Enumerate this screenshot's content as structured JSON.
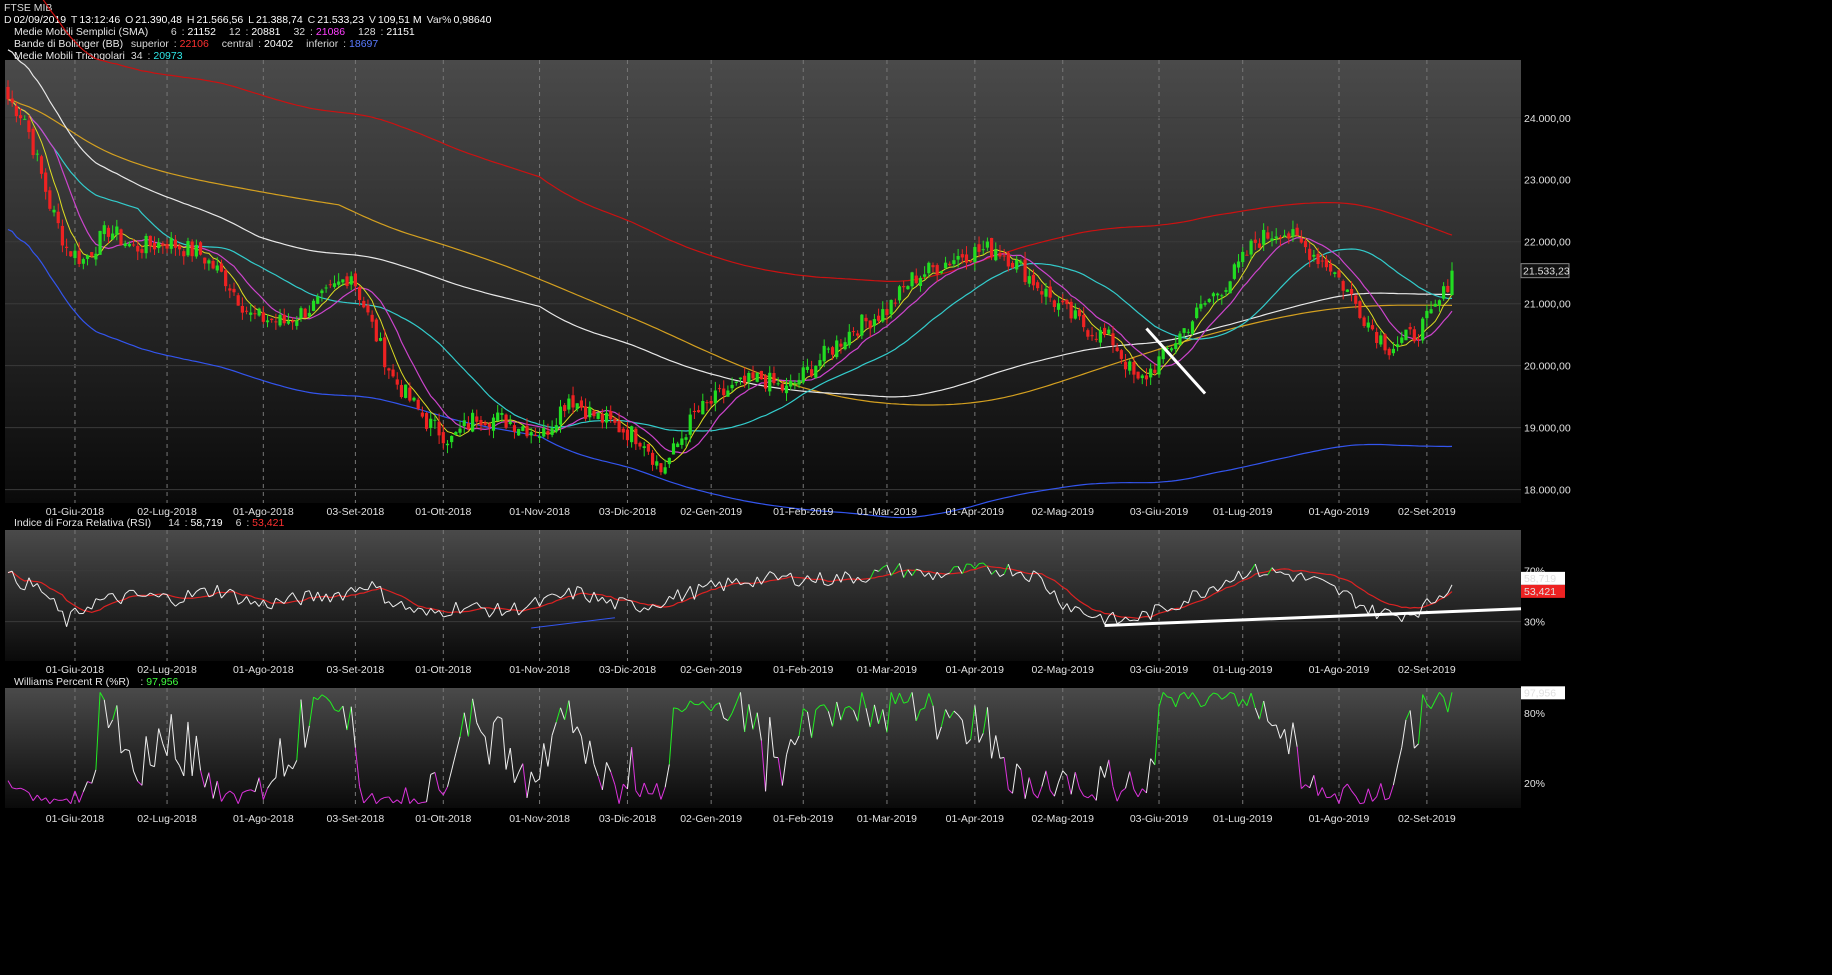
{
  "header": {
    "title": "FTSE MIB",
    "ohlc": {
      "d_label": "D",
      "date": "02/09/2019",
      "t_label": "T",
      "time": "13:12:46",
      "o_label": "O",
      "open": "21.390,48",
      "h_label": "H",
      "high": "21.566,56",
      "l_label": "L",
      "low": "21.388,74",
      "c_label": "C",
      "close": "21.533,23",
      "v_label": "V",
      "volume": "109,51 M",
      "var_label": "Var%",
      "var": "0,98640"
    },
    "sma": {
      "label": "Medie Mobili Semplici (SMA)",
      "p1": "6",
      "v1": "21152",
      "p2": "12",
      "v2": "20881",
      "p3": "32",
      "v3": "21086",
      "p4": "128",
      "v4": "21151"
    },
    "bb": {
      "label": "Bande di Bollinger (BB)",
      "sup_label": "superior",
      "sup": "22106",
      "cen_label": "central",
      "cen": "20402",
      "inf_label": "inferior",
      "inf": "18697"
    },
    "tma": {
      "label": "Medie Mobili Triangolari",
      "p": "34",
      "v": "20973"
    }
  },
  "rsi_header": {
    "label": "Indice di Forza Relativa (RSI)",
    "p1": "14",
    "v1": "58,719",
    "p2": "6",
    "v2": "53,421"
  },
  "wr_header": {
    "label": "Williams Percent R (%R)",
    "v": "97,956"
  },
  "colors": {
    "up": "#22dd22",
    "down": "#ee2222",
    "bb_upper": "#cc1111",
    "bb_lower": "#3355ee",
    "sma6": "#dddd22",
    "sma12": "#cc44cc",
    "sma32": "#33cccc",
    "sma128": "#e8e8e8",
    "tma": "#d4a020",
    "trend": "#ffffff",
    "grid": "#777777"
  },
  "chart_data": [
    {
      "type": "candlestick",
      "title": "FTSE MIB",
      "ylim": [
        17800,
        24900
      ],
      "y_ticks": [
        "18.000,00",
        "19.000,00",
        "20.000,00",
        "21.000,00",
        "22.000,00",
        "23.000,00",
        "24.000,00"
      ],
      "last_label": "21.533,23",
      "x_labels": [
        "01-Giu-2018",
        "02-Lug-2018",
        "01-Ago-2018",
        "03-Set-2018",
        "01-Ott-2018",
        "01-Nov-2018",
        "03-Dic-2018",
        "02-Gen-2019",
        "01-Feb-2019",
        "01-Mar-2019",
        "01-Apr-2019",
        "02-Mag-2019",
        "03-Giu-2019",
        "01-Lug-2019",
        "01-Ago-2019",
        "02-Set-2019"
      ],
      "close_keypoints": [
        [
          0,
          24300
        ],
        [
          4,
          24000
        ],
        [
          10,
          22600
        ],
        [
          14,
          21900
        ],
        [
          18,
          21700
        ],
        [
          24,
          22200
        ],
        [
          30,
          21900
        ],
        [
          38,
          22000
        ],
        [
          46,
          21800
        ],
        [
          52,
          21400
        ],
        [
          58,
          20800
        ],
        [
          66,
          20700
        ],
        [
          74,
          21000
        ],
        [
          82,
          21500
        ],
        [
          86,
          20800
        ],
        [
          92,
          19800
        ],
        [
          100,
          19100
        ],
        [
          106,
          18800
        ],
        [
          112,
          19200
        ],
        [
          120,
          19100
        ],
        [
          128,
          18900
        ],
        [
          134,
          19500
        ],
        [
          140,
          19200
        ],
        [
          146,
          19000
        ],
        [
          152,
          18800
        ],
        [
          156,
          18300
        ],
        [
          158,
          18500
        ],
        [
          164,
          19200
        ],
        [
          172,
          19600
        ],
        [
          180,
          19800
        ],
        [
          186,
          19600
        ],
        [
          194,
          20100
        ],
        [
          202,
          20600
        ],
        [
          210,
          20900
        ],
        [
          216,
          21400
        ],
        [
          222,
          21600
        ],
        [
          228,
          21800
        ],
        [
          236,
          21900
        ],
        [
          240,
          21700
        ],
        [
          246,
          21300
        ],
        [
          252,
          20900
        ],
        [
          258,
          20600
        ],
        [
          264,
          20400
        ],
        [
          270,
          19700
        ],
        [
          274,
          20000
        ],
        [
          280,
          20500
        ],
        [
          286,
          21000
        ],
        [
          292,
          21400
        ],
        [
          298,
          22000
        ],
        [
          304,
          22200
        ],
        [
          310,
          21900
        ],
        [
          316,
          21600
        ],
        [
          322,
          21000
        ],
        [
          326,
          20600
        ],
        [
          330,
          20300
        ],
        [
          336,
          20500
        ],
        [
          340,
          20800
        ],
        [
          343,
          21150
        ],
        [
          345,
          21533
        ]
      ],
      "sma6_last": 21152,
      "sma12_last": 20881,
      "sma32_last": 21086,
      "sma128_last": 21151,
      "bb_upper_last": 22106,
      "bb_central_last": 20402,
      "bb_lower_last": 18697,
      "tma34_last": 20973
    },
    {
      "type": "line",
      "title": "Indice di Forza Relativa (RSI)",
      "ylim": [
        0,
        100
      ],
      "y_ticks": [
        "70%",
        "30%"
      ],
      "series": [
        {
          "name": "14",
          "last": 58.719
        },
        {
          "name": "6",
          "last": 53.421
        }
      ],
      "last_labels": [
        "58,719",
        "53,421"
      ],
      "rsi_keypoints": [
        [
          0,
          65
        ],
        [
          8,
          55
        ],
        [
          14,
          30
        ],
        [
          20,
          45
        ],
        [
          30,
          50
        ],
        [
          40,
          48
        ],
        [
          50,
          55
        ],
        [
          60,
          43
        ],
        [
          70,
          48
        ],
        [
          80,
          52
        ],
        [
          86,
          60
        ],
        [
          92,
          45
        ],
        [
          100,
          35
        ],
        [
          108,
          42
        ],
        [
          118,
          38
        ],
        [
          128,
          45
        ],
        [
          136,
          53
        ],
        [
          144,
          44
        ],
        [
          152,
          42
        ],
        [
          158,
          48
        ],
        [
          166,
          55
        ],
        [
          176,
          62
        ],
        [
          186,
          64
        ],
        [
          196,
          63
        ],
        [
          206,
          66
        ],
        [
          212,
          71
        ],
        [
          220,
          66
        ],
        [
          230,
          70
        ],
        [
          240,
          71
        ],
        [
          246,
          65
        ],
        [
          252,
          45
        ],
        [
          258,
          36
        ],
        [
          266,
          30
        ],
        [
          272,
          35
        ],
        [
          280,
          45
        ],
        [
          288,
          58
        ],
        [
          296,
          70
        ],
        [
          304,
          68
        ],
        [
          312,
          62
        ],
        [
          320,
          50
        ],
        [
          326,
          38
        ],
        [
          332,
          35
        ],
        [
          338,
          40
        ],
        [
          345,
          59
        ]
      ]
    },
    {
      "type": "line",
      "title": "Williams Percent R (%R)",
      "ylim": [
        0,
        100
      ],
      "y_ticks": [
        "80%",
        "20%"
      ],
      "last_label": "97,956"
    }
  ]
}
